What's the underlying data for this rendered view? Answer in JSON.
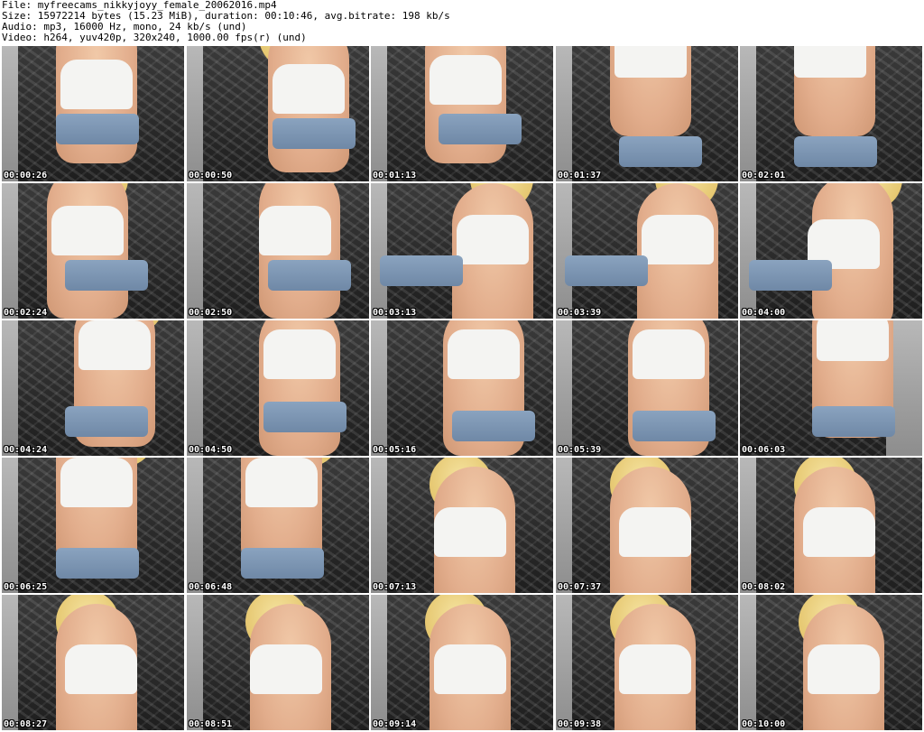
{
  "header": {
    "file_line": "File: myfreecams_nikkyjoyy_female_20062016.mp4",
    "size_line": "Size: 15972214 bytes (15.23 MiB), duration: 00:10:46, avg.bitrate: 198 kb/s",
    "audio_line": "Audio: mp3, 16000 Hz, mono, 24 kb/s (und)",
    "video_line": "Video: h264, yuv420p, 320x240, 1000.00 fps(r) (und)"
  },
  "thumbnails": [
    "00:00:26",
    "00:00:50",
    "00:01:13",
    "00:01:37",
    "00:02:01",
    "00:02:24",
    "00:02:50",
    "00:03:13",
    "00:03:39",
    "00:04:00",
    "00:04:24",
    "00:04:50",
    "00:05:16",
    "00:05:39",
    "00:06:03",
    "00:06:25",
    "00:06:48",
    "00:07:13",
    "00:07:37",
    "00:08:02",
    "00:08:27",
    "00:08:51",
    "00:09:14",
    "00:09:38",
    "00:10:00"
  ]
}
